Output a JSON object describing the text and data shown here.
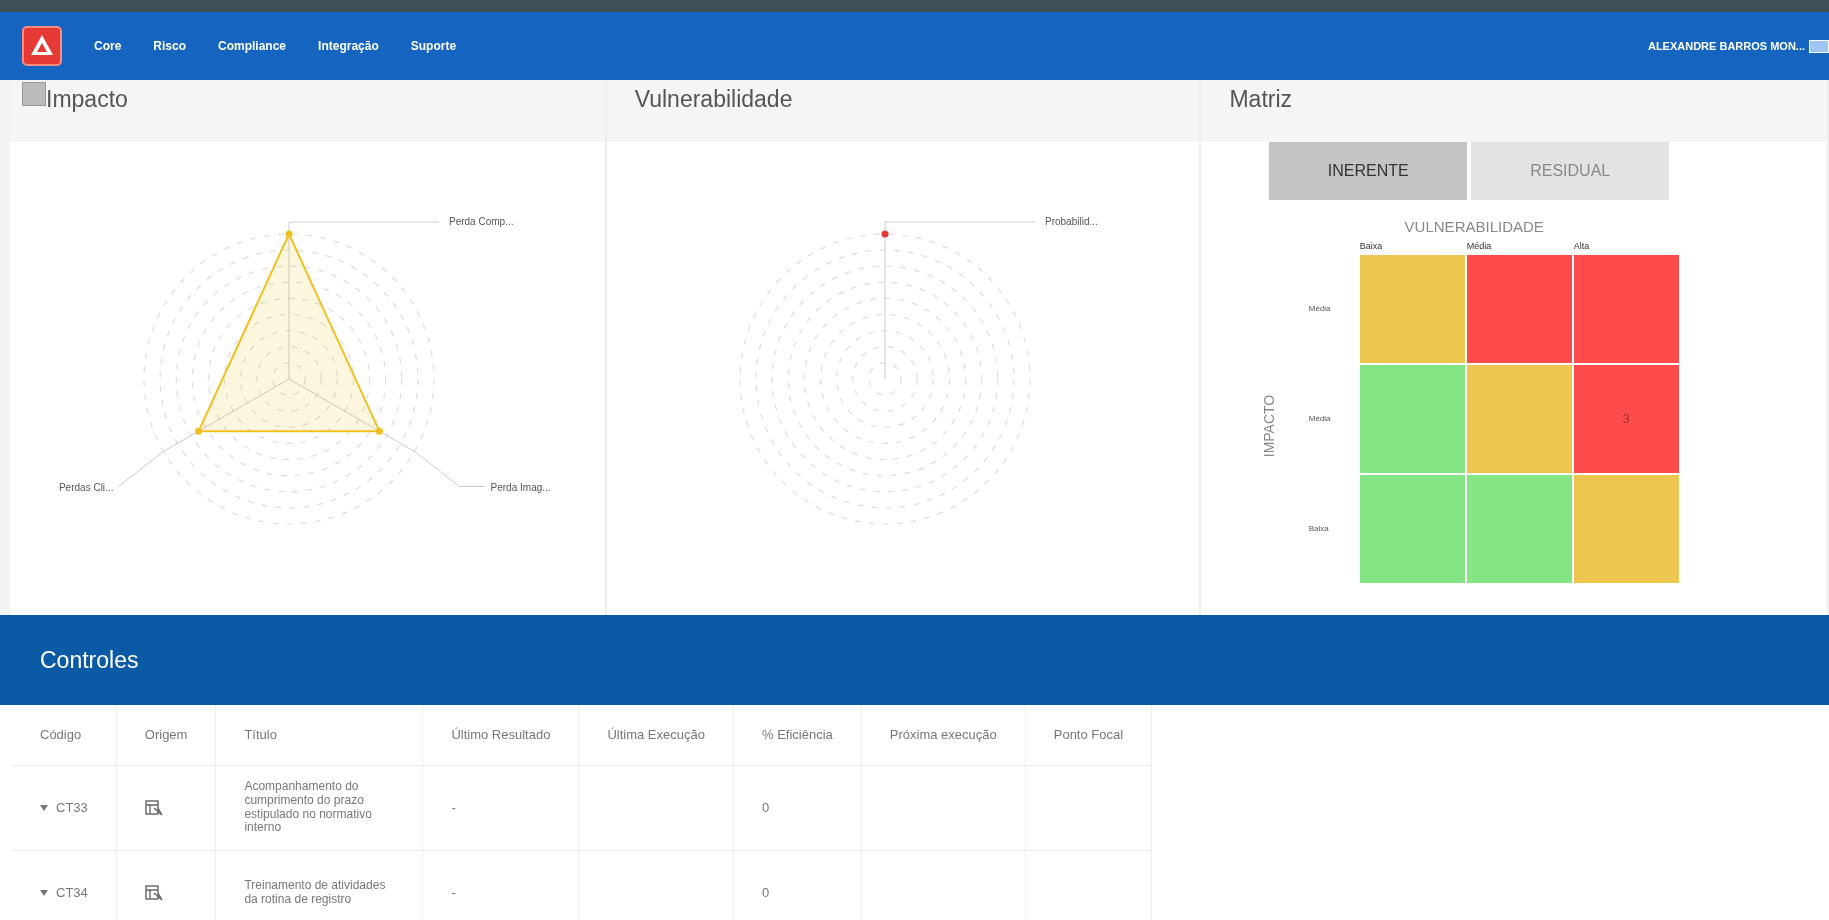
{
  "navbar": {
    "menu": [
      {
        "label": "Core"
      },
      {
        "label": "Risco"
      },
      {
        "label": "Compliance"
      },
      {
        "label": "Integração"
      },
      {
        "label": "Suporte"
      }
    ],
    "user": "ALEXANDRE BARROS MON..."
  },
  "panels": [
    {
      "kind": "radar",
      "title": "Impacto",
      "axes": [
        "Perda Comp...",
        "Perda Imag...",
        "Perdas Cli..."
      ],
      "color": "#f0c020"
    },
    {
      "kind": "radar",
      "title": "Vulnerabilidade",
      "axes": [
        "Probabilid..."
      ],
      "color": "#e53935"
    },
    {
      "kind": "matrix",
      "title": "Matriz",
      "tabs": [
        {
          "label": "INERENTE",
          "selected": true
        },
        {
          "label": "RESIDUAL",
          "selected": false
        }
      ],
      "x_title": "VULNERABILIDADE",
      "y_title": "IMPACTO",
      "columns": [
        "Baixa",
        "Média",
        "Alta"
      ],
      "rows": [
        {
          "label": "Média",
          "cells": [
            {
              "color": "#ecc64f"
            },
            {
              "color": "#fd4b4b"
            },
            {
              "color": "#fd4b4b"
            }
          ]
        },
        {
          "label": "Média",
          "cells": [
            {
              "color": "#84e584"
            },
            {
              "color": "#ecc64f"
            },
            {
              "color": "#fd4b4b",
              "value": "3"
            }
          ]
        },
        {
          "label": "Baixa",
          "cells": [
            {
              "color": "#84e584"
            },
            {
              "color": "#84e584"
            },
            {
              "color": "#ecc64f"
            }
          ]
        }
      ]
    }
  ],
  "controls": {
    "title": "Controles",
    "columns": [
      "Código",
      "Origem",
      "Título",
      "Último Resultado",
      "Última Execução",
      "% Eficiência",
      "Próxima execução",
      "Ponto Focal"
    ],
    "rows": [
      {
        "code": "CT33",
        "title": "Acompanhamento do cumprimento do prazo estipulado no normativo interno",
        "last_result": "-",
        "efficiency": "0"
      },
      {
        "code": "CT34",
        "title": "Treinamento de atividades da rotina de registro",
        "last_result": "-",
        "efficiency": "0"
      }
    ]
  }
}
